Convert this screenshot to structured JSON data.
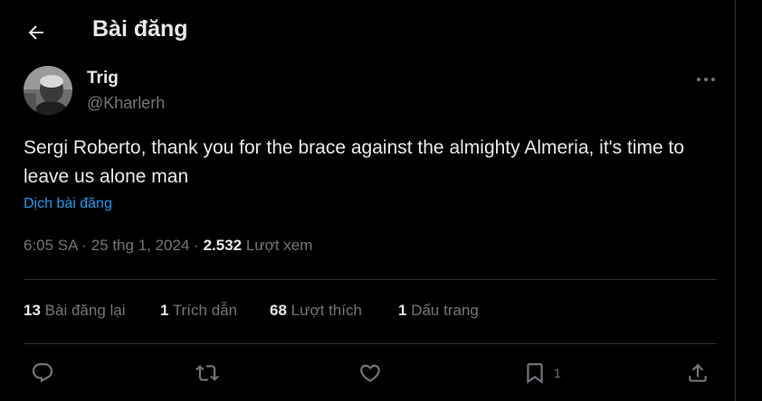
{
  "header": {
    "title": "Bài đăng",
    "back_icon": "back-arrow-icon"
  },
  "post": {
    "author": {
      "name": "Trig",
      "handle": "@Kharlerh"
    },
    "text": "Sergi Roberto, thank you for the brace against the almighty Almeria, it's time to leave us alone man",
    "translate_label": "Dịch bài đăng",
    "time": "6:05 SA",
    "date": "25 thg 1, 2024",
    "separator": "·",
    "views_count": "2.532",
    "views_label": "Lượt xem"
  },
  "stats": {
    "reposts_count": "13",
    "reposts_label": "Bài đăng lại",
    "quotes_count": "1",
    "quotes_label": "Trích dẫn",
    "likes_count": "68",
    "likes_label": "Lượt thích",
    "bookmarks_count": "1",
    "bookmarks_label": "Dấu trang"
  },
  "actions": {
    "reply_icon": "reply-icon",
    "repost_icon": "repost-icon",
    "like_icon": "heart-icon",
    "bookmark_icon": "bookmark-icon",
    "bookmark_count": "1",
    "share_icon": "share-icon"
  },
  "colors": {
    "background": "#000000",
    "text_primary": "#e7e9ea",
    "text_secondary": "#71767b",
    "link": "#1d9bf0",
    "border": "#2f3336"
  }
}
